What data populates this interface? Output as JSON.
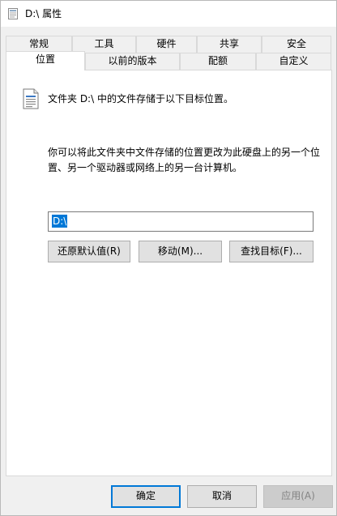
{
  "window": {
    "title": "D:\\ 属性"
  },
  "tabs_row1": [
    {
      "label": "常规"
    },
    {
      "label": "工具"
    },
    {
      "label": "硬件"
    },
    {
      "label": "共享"
    },
    {
      "label": "安全"
    }
  ],
  "tabs_row2": [
    {
      "label": "位置",
      "active": true
    },
    {
      "label": "以前的版本"
    },
    {
      "label": "配额"
    },
    {
      "label": "自定义"
    }
  ],
  "panel": {
    "intro": "文件夹 D:\\ 中的文件存储于以下目标位置。",
    "description": "你可以将此文件夹中文件存储的位置更改为此硬盘上的另一个位置、另一个驱动器或网络上的另一台计算机。",
    "path_value": "D:\\",
    "restore_button": "还原默认值(R)",
    "move_button": "移动(M)...",
    "find_target_button": "查找目标(F)..."
  },
  "footer": {
    "ok_button": "确定",
    "cancel_button": "取消",
    "apply_button": "应用(A)"
  },
  "colors": {
    "accent": "#0078d7",
    "window_bg": "#f0f0f0",
    "panel_bg": "#ffffff",
    "button_bg": "#e1e1e1"
  },
  "icons": {
    "title": "drive-properties-icon",
    "folder": "document-folder-icon"
  }
}
